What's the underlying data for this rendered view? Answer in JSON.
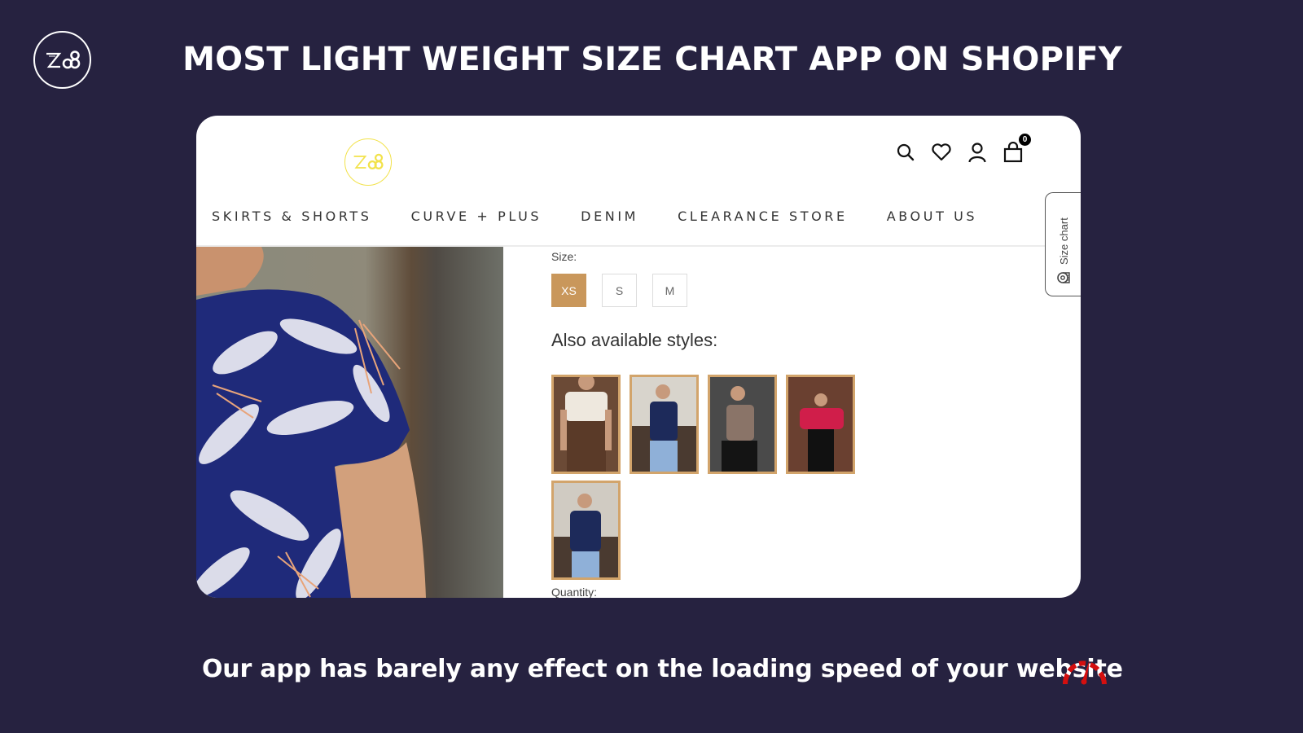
{
  "brand": {
    "logo_text": "Z∞8"
  },
  "headline": "MOST LIGHT WEIGHT SIZE CHART APP ON SHOPIFY",
  "store": {
    "logo_text": "Z∞8",
    "header_icons": [
      "search-icon",
      "heart-icon",
      "user-icon",
      "cart-icon"
    ],
    "cart_count": "0",
    "nav": [
      "SKIRTS & SHORTS",
      "CURVE + PLUS",
      "DENIM",
      "CLEARANCE STORE",
      "ABOUT US"
    ],
    "size_label": "Size:",
    "sizes": [
      {
        "label": "XS",
        "selected": true
      },
      {
        "label": "S",
        "selected": false
      },
      {
        "label": "M",
        "selected": false
      }
    ],
    "styles_title": "Also available styles:",
    "style_thumbnails": [
      "white lace crop top with brown skirt",
      "navy sleeveless top with jeans",
      "printed halter top with black pants",
      "red blouse with black pants",
      "navy ruffle top with jeans"
    ],
    "quantity_label": "Quantity:",
    "size_chart_tab": "Size chart"
  },
  "tagline": "Our app has barely any effect on the loading speed of your website",
  "colors": {
    "background": "#262240",
    "accent_gold": "#c9975b",
    "store_logo_yellow": "#f2e24a",
    "speed_red": "#d40f0f"
  }
}
